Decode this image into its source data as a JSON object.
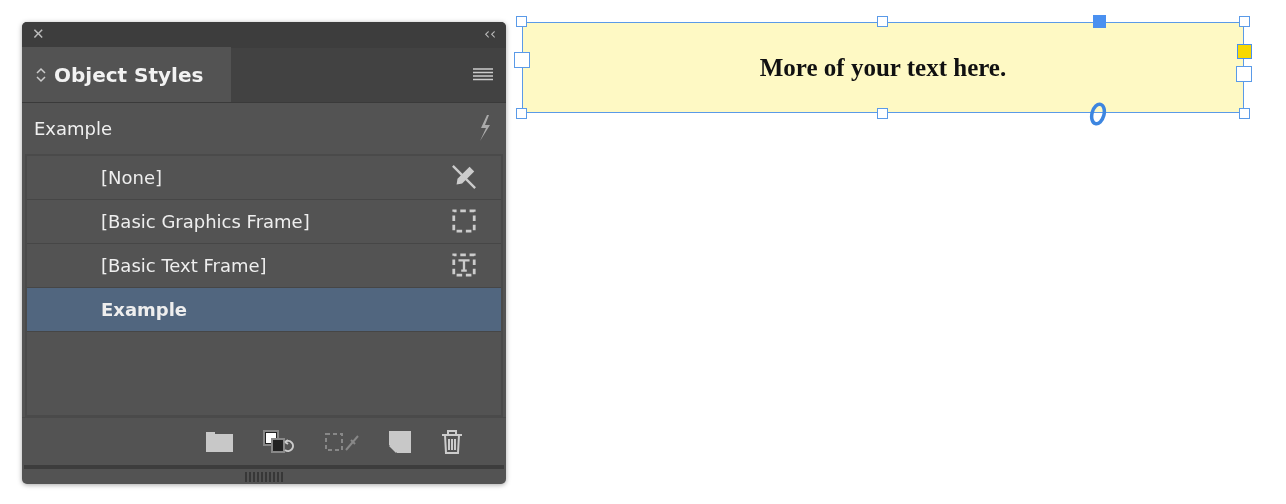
{
  "panel": {
    "close": "✕",
    "collapse": "‹‹",
    "tab": {
      "label": "Object Styles",
      "selected": true
    },
    "current_style": "Example",
    "styles": [
      {
        "name": "[None]",
        "selected": false,
        "kind": "none"
      },
      {
        "name": "[Basic Graphics Frame]",
        "selected": false,
        "kind": "graphics"
      },
      {
        "name": "[Basic Text Frame]",
        "selected": false,
        "kind": "text"
      },
      {
        "name": "Example",
        "selected": true,
        "kind": "plain"
      }
    ]
  },
  "text_frame": {
    "text": "More of your text here."
  }
}
